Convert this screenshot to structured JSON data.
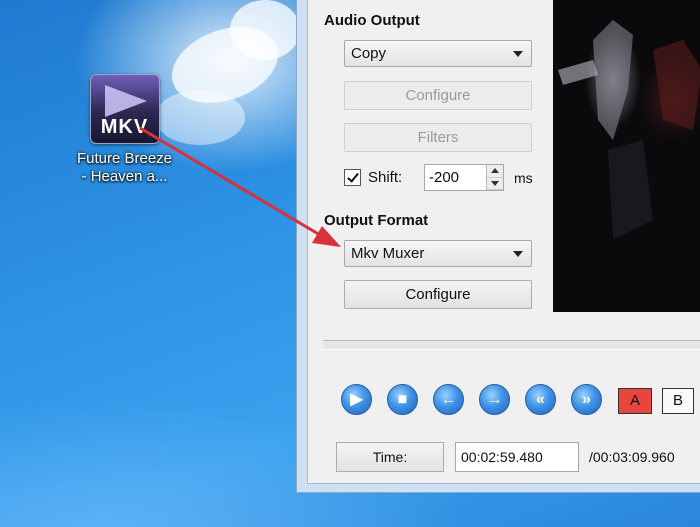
{
  "desktop": {
    "file_icon": {
      "badge": "MKV",
      "label_line1": "Future Breeze",
      "label_line2": "- Heaven a..."
    }
  },
  "audio_output": {
    "title": "Audio Output",
    "codec": "Copy",
    "configure_label": "Configure",
    "filters_label": "Filters",
    "shift": {
      "checked": true,
      "label": "Shift:",
      "value": "-200",
      "unit": "ms"
    }
  },
  "output_format": {
    "title": "Output Format",
    "muxer": "Mkv Muxer",
    "configure_label": "Configure"
  },
  "playback": {
    "controls": [
      "play-icon",
      "stop-icon",
      "previous-icon",
      "next-icon",
      "rewind-icon",
      "fast-forward-icon"
    ],
    "marker_a": "A",
    "marker_b": "B",
    "time_button_label": "Time:",
    "current_time": "00:02:59.480",
    "total_time": "/00:03:09.960"
  },
  "colors": {
    "annotation_arrow": "#d9313a",
    "marker_a_bg": "#e8453c",
    "control_blue": "#3f93e8"
  }
}
